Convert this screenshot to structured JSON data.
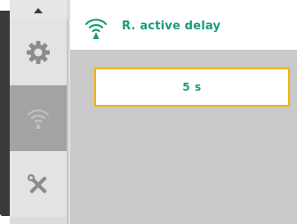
{
  "header": {
    "title": "R. active delay",
    "icon": "wireless-signal-icon"
  },
  "sidebar": {
    "items": [
      {
        "icon": "gear-icon",
        "selected": false
      },
      {
        "icon": "wireless-signal-icon",
        "selected": true
      },
      {
        "icon": "tools-icon",
        "selected": false
      }
    ]
  },
  "main": {
    "value": "5 s"
  },
  "colors": {
    "accent": "#1a9a7a",
    "focus_border": "#f0b400",
    "panel_bg": "#c9c9c9",
    "sidebar_selected": "#a3a3a3"
  }
}
